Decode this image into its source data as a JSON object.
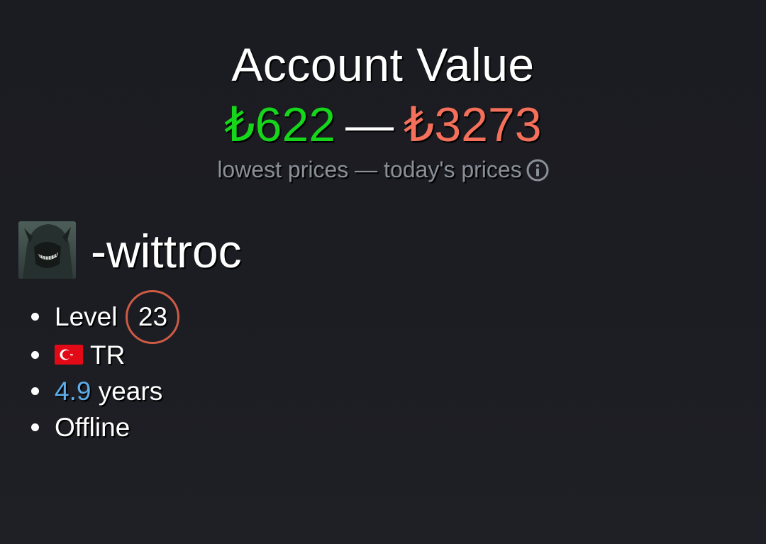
{
  "header": {
    "title": "Account Value",
    "value_low": "₺622",
    "separator": "—",
    "value_high": "₺3273",
    "subtitle": "lowest prices — today's prices",
    "info_icon": "info-circle-icon"
  },
  "profile": {
    "avatar_icon": "hooded-figure-avatar",
    "username": "-wittroc",
    "level_label": "Level",
    "level_value": "23",
    "country_flag": "turkey-flag-icon",
    "country_code": "TR",
    "years_value": "4.9",
    "years_label": "years",
    "status": "Offline"
  },
  "colors": {
    "background": "#1b1c21",
    "low_value": "#16d61b",
    "high_value": "#f4705a",
    "subtitle": "#8a8f98",
    "level_ring": "#cd5b45",
    "years_value": "#5cade8"
  }
}
